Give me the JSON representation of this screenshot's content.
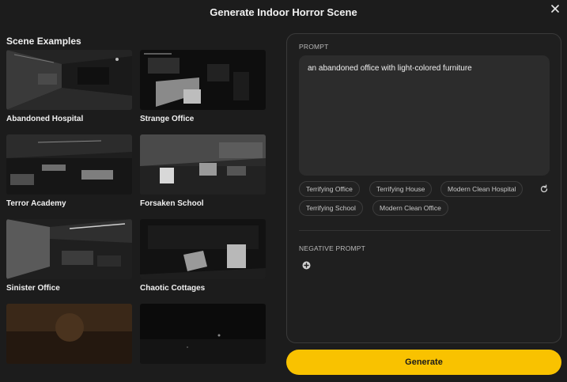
{
  "modal": {
    "title": "Generate Indoor Horror Scene"
  },
  "examples": {
    "title": "Scene Examples",
    "items": [
      {
        "label": "Abandoned Hospital"
      },
      {
        "label": "Strange Office"
      },
      {
        "label": "Terror Academy"
      },
      {
        "label": "Forsaken School"
      },
      {
        "label": "Sinister Office"
      },
      {
        "label": "Chaotic Cottages"
      },
      {
        "label": ""
      },
      {
        "label": ""
      }
    ]
  },
  "prompt": {
    "label": "PROMPT",
    "value": "an abandoned office with light-colored furniture",
    "suggestions": [
      "Terrifying Office",
      "Terrifying House",
      "Modern Clean Hospital",
      "Terrifying School",
      "Modern Clean Office"
    ]
  },
  "negative_prompt": {
    "label": "NEGATIVE PROMPT"
  },
  "actions": {
    "generate_label": "Generate"
  },
  "colors": {
    "accent": "#f9c200",
    "background": "#1c1c1c",
    "panel": "#1f1f1f"
  },
  "icons": {
    "close": "close-icon",
    "refresh": "refresh-icon",
    "add": "plus-circle-icon"
  }
}
